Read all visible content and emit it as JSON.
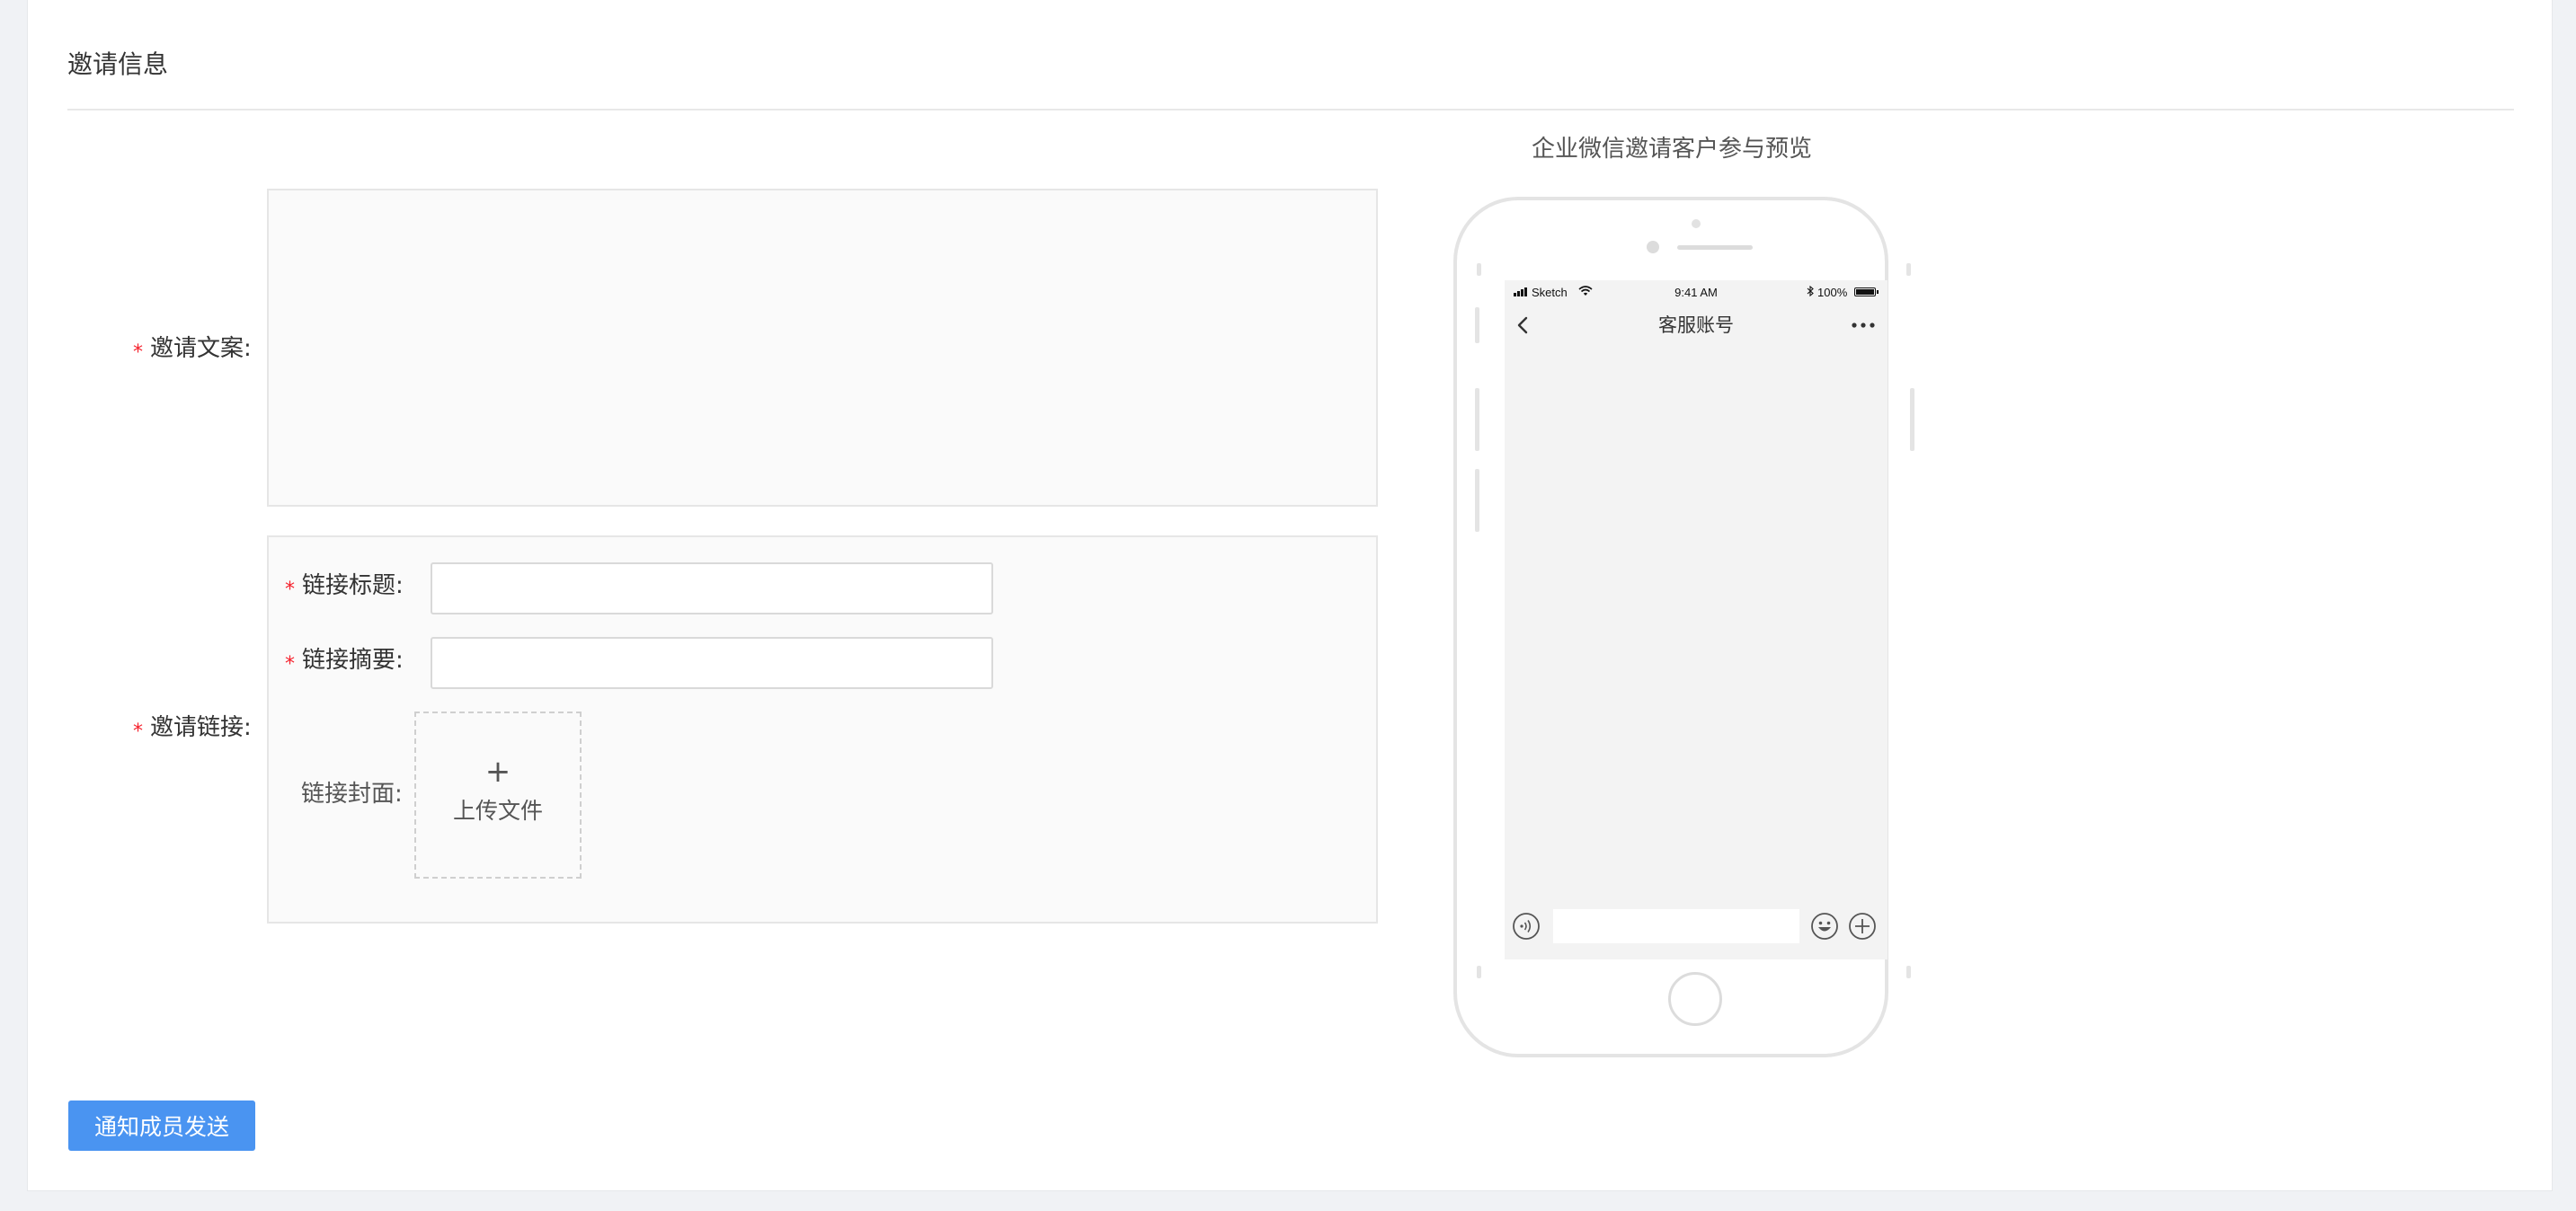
{
  "section": {
    "title": "邀请信息"
  },
  "form": {
    "invite_copy_label": "邀请文案:",
    "invite_link_label": "邀请链接:",
    "required_mark": "*",
    "invite_copy_value": "",
    "link": {
      "title_label": "链接标题:",
      "title_value": "",
      "summary_label": "链接摘要:",
      "summary_value": "",
      "cover_label": "链接封面:",
      "upload_plus": "+",
      "upload_text": "上传文件"
    }
  },
  "actions": {
    "notify_button": "通知成员发送"
  },
  "preview": {
    "title": "企业微信邀请客户参与预览",
    "status_bar": {
      "carrier": "Sketch",
      "time": "9:41 AM",
      "battery": "100%"
    },
    "chat": {
      "title": "客服账号"
    }
  },
  "colors": {
    "primary": "#4a94f1",
    "required": "#f5222d"
  }
}
